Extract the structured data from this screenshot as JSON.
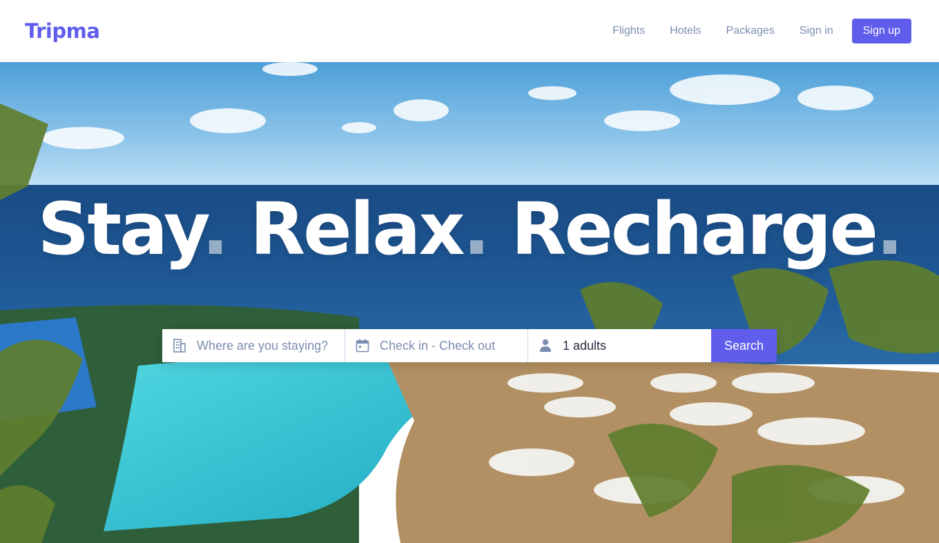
{
  "header": {
    "logo": "Tripma",
    "nav": {
      "flights": "Flights",
      "hotels": "Hotels",
      "packages": "Packages",
      "signin": "Sign in",
      "signup": "Sign up"
    }
  },
  "hero": {
    "headline": {
      "word1": "Stay",
      "word2": "Relax",
      "word3": "Recharge",
      "dot": "."
    },
    "search": {
      "destination_placeholder": "Where are you staying?",
      "dates_placeholder": "Check in - Check out",
      "guests_value": "1 adults",
      "search_label": "Search",
      "icons": {
        "destination": "building-icon",
        "dates": "calendar-icon",
        "guests": "person-icon"
      }
    }
  },
  "colors": {
    "brand": "#605DEC",
    "nav_text": "#7C8DB0",
    "input_text": "#27273F"
  }
}
